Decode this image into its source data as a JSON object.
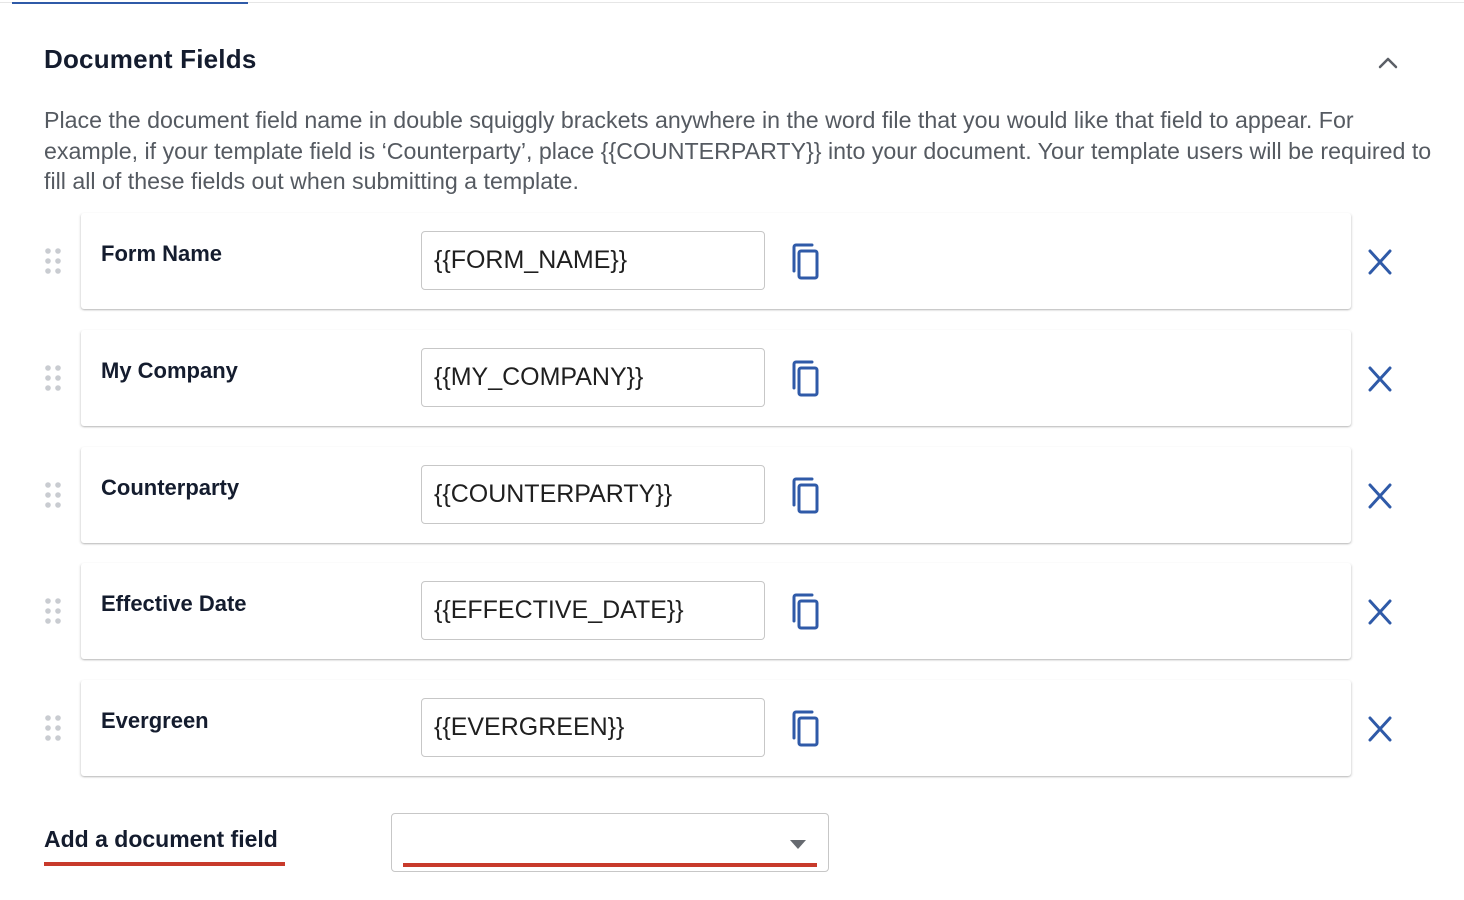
{
  "section": {
    "title": "Document Fields",
    "collapse_icon": "chevron-up-icon",
    "description": "Place the document field name in double squiggly brackets anywhere in the word file that you would like that field to appear. For example, if your template field is ‘Counterparty’, place {{COUNTERPARTY}} into your document. Your template users will be required to fill all of these fields out when submitting a template."
  },
  "fields": [
    {
      "label": "Form Name",
      "value": "{{FORM_NAME}}"
    },
    {
      "label": "My Company",
      "value": "{{MY_COMPANY}}"
    },
    {
      "label": "Counterparty",
      "value": "{{COUNTERPARTY}}"
    },
    {
      "label": "Effective Date",
      "value": "{{EFFECTIVE_DATE}}"
    },
    {
      "label": "Evergreen",
      "value": "{{EVERGREEN}}"
    }
  ],
  "row_icons": {
    "drag": "drag-handle-icon",
    "copy": "copy-icon",
    "delete": "close-icon"
  },
  "add_field": {
    "label": "Add a document field",
    "selected_value": ""
  },
  "colors": {
    "accent_blue": "#2f5aa8",
    "error_red": "#c83a2b",
    "title_text": "#141c2e",
    "body_text": "#555a61"
  }
}
